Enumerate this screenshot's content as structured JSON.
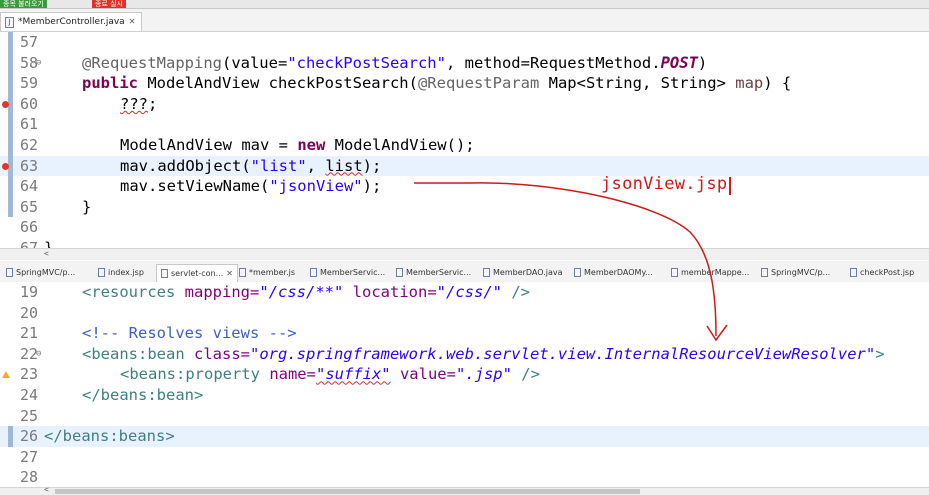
{
  "toolbar": {
    "green_chip": "종목 불러오기",
    "red_chip": "종료 실시"
  },
  "editor_top": {
    "tab": "*MemberController.java",
    "lines": [
      {
        "num": "57"
      },
      {
        "num": "58",
        "ann": "@RequestMapping",
        "p1": "(value=",
        "s1": "\"checkPostSearch\"",
        "p2": ", method=RequestMethod.",
        "kw": "POST",
        "p3": ")"
      },
      {
        "num": "59",
        "kw1": "public",
        "p1": " ModelAndView checkPostSearch(",
        "ann": "@RequestParam",
        "p2": " Map<String, String> ",
        "var": "map",
        "p3": ") {"
      },
      {
        "num": "60",
        "text": "???",
        "end": ";"
      },
      {
        "num": "61"
      },
      {
        "num": "62",
        "p1": "ModelAndView mav = ",
        "kw": "new",
        "p2": " ModelAndView();"
      },
      {
        "num": "63",
        "p1": "mav.addObject(",
        "s1": "\"list\"",
        "p2": ", ",
        "err": "list",
        "p3": ");"
      },
      {
        "num": "64",
        "p1": "mav.setViewName(",
        "s1": "\"jsonView\"",
        "p2": ");"
      },
      {
        "num": "65",
        "text": "}"
      },
      {
        "num": "66"
      },
      {
        "num": "67",
        "text": "}"
      }
    ]
  },
  "annotation": {
    "label": "jsonView.jsp"
  },
  "editor_tabs": [
    {
      "icon": "jsp-file-icon",
      "label": "SpringMVC/p..."
    },
    {
      "icon": "jsp-file-icon",
      "label": "index.jsp"
    },
    {
      "icon": "xml-file-icon",
      "label": "servlet-con...",
      "active": true
    },
    {
      "icon": "js-file-icon",
      "label": "*member.js"
    },
    {
      "icon": "java-file-icon",
      "label": "MemberServic..."
    },
    {
      "icon": "java-file-icon",
      "label": "MemberServic..."
    },
    {
      "icon": "java-file-icon",
      "label": "MemberDAO.java"
    },
    {
      "icon": "java-file-icon",
      "label": "MemberDAOMy..."
    },
    {
      "icon": "xml-file-icon",
      "label": "memberMappe..."
    },
    {
      "icon": "jsp-file-icon",
      "label": "SpringMVC/p..."
    },
    {
      "icon": "jsp-file-icon",
      "label": "checkPost.jsp"
    }
  ],
  "editor_bottom": {
    "lines": [
      {
        "num": "19",
        "t1": "<resources",
        "a1": " mapping=",
        "v1": "\"/css/**\"",
        "a2": " location=",
        "v2": "\"/css/\"",
        "t2": " />"
      },
      {
        "num": "20"
      },
      {
        "num": "21",
        "comment": "<!-- Resolves views -->"
      },
      {
        "num": "22",
        "t1": "<beans:bean",
        "a1": " class=",
        "v1": "\"org.springframework.web.servlet.view.InternalResourceViewResolver\"",
        "t2": ">"
      },
      {
        "num": "23",
        "t1": "<beans:property",
        "a1": " name=",
        "v1": "\"suffix\"",
        "a2": " value=",
        "v2": "\".jsp\"",
        "t2": " />"
      },
      {
        "num": "24",
        "t1": "</beans:bean>"
      },
      {
        "num": "25"
      },
      {
        "num": "26",
        "t1": "</beans:beans>"
      },
      {
        "num": "27"
      },
      {
        "num": "28"
      }
    ]
  },
  "colors": {
    "annotation_red": "#cc1a1a",
    "keyword": "#7f0055",
    "string": "#2a00ff",
    "tag": "#3f7f7f",
    "attr": "#7f007f",
    "comment": "#3f5fbf"
  }
}
